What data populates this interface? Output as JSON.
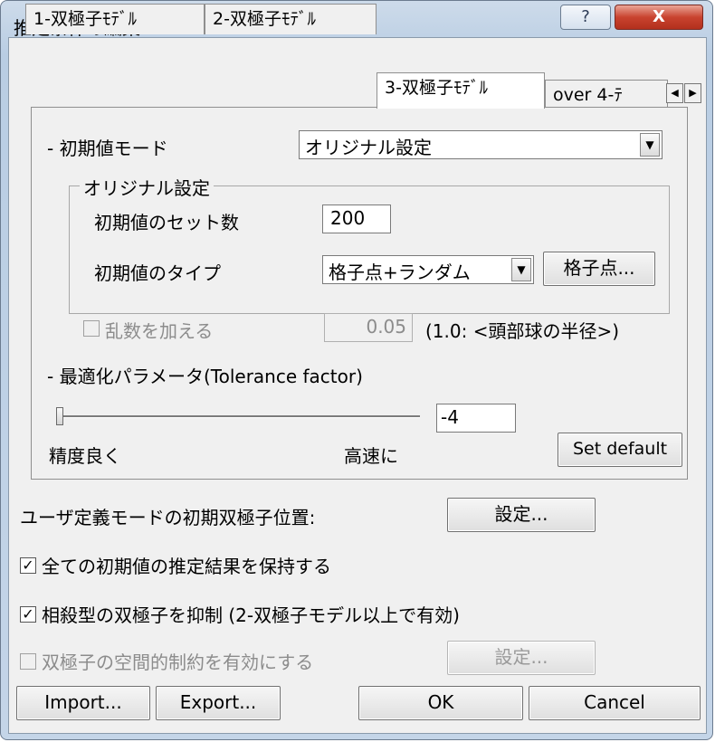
{
  "window": {
    "title": "推定条件の編集",
    "help_glyph": "?",
    "close_glyph": "X"
  },
  "tabs": [
    {
      "label": "1-双極子ﾓﾃﾞﾙ"
    },
    {
      "label": "2-双極子ﾓﾃﾞﾙ"
    },
    {
      "label": "3-双極子ﾓﾃﾞﾙ"
    },
    {
      "label": "over 4-ﾃ"
    }
  ],
  "tab_scroll": {
    "left": "◀",
    "right": "▶"
  },
  "initial_mode": {
    "label": "- 初期値モード",
    "selected": "オリジナル設定",
    "drop": "▼"
  },
  "original_group": {
    "title": "オリジナル設定",
    "set_count_label": "初期値のセット数",
    "set_count_value": "200",
    "type_label": "初期値のタイプ",
    "type_selected": "格子点+ランダム",
    "grid_button": "格子点..."
  },
  "random": {
    "label": "乱数を加える",
    "value": "0.05",
    "note": "(1.0: <頭部球の半径>)",
    "checked": false
  },
  "optimize": {
    "label": "- 最適化パラメータ(Tolerance factor)",
    "value": "-4",
    "slider_fraction": 0.0,
    "left_label": "精度良く",
    "right_label": "高速に",
    "default_button": "Set default"
  },
  "user_mode": {
    "label": "ユーザ定義モードの初期双極子位置:",
    "button": "設定..."
  },
  "checks": [
    {
      "label": "全ての初期値の推定結果を保持する",
      "checked": true,
      "mark": "✓"
    },
    {
      "label": "相殺型の双極子を抑制 (2-双極子モデル以上で有効)",
      "checked": true,
      "mark": "✓"
    },
    {
      "label": "双極子の空間的制約を有効にする",
      "checked": false,
      "mark": ""
    }
  ],
  "spatial_button": "設定...",
  "footer": {
    "import": "Import...",
    "export": "Export...",
    "ok": "OK",
    "cancel": "Cancel"
  }
}
